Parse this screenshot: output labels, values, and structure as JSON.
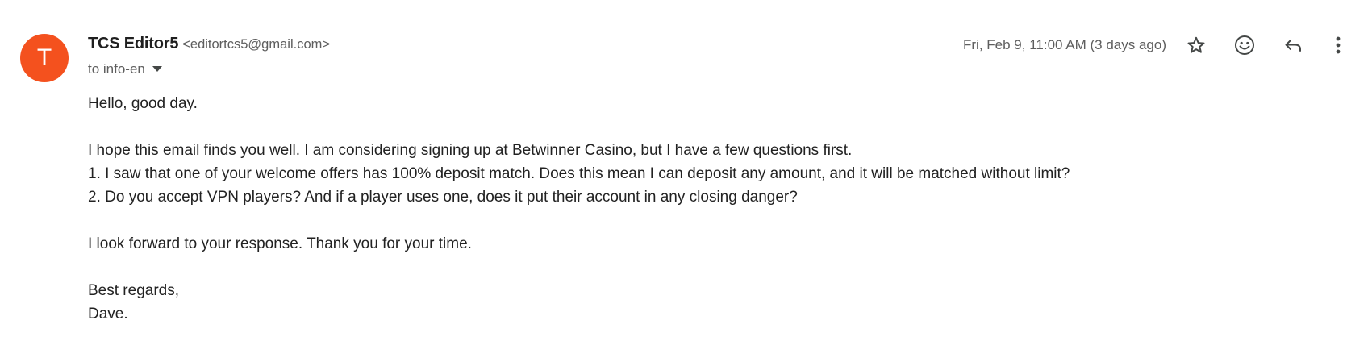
{
  "sender": {
    "avatar_letter": "T",
    "avatar_color": "#f4511e",
    "name": "TCS Editor5",
    "email": "<editortcs5@gmail.com>"
  },
  "recipient": {
    "label": "to info-en"
  },
  "date": "Fri, Feb 9, 11:00 AM (3 days ago)",
  "actions": [
    {
      "icon": "star-icon",
      "label": "Star"
    },
    {
      "icon": "emoji-icon",
      "label": "Add reaction"
    },
    {
      "icon": "reply-icon",
      "label": "Reply"
    },
    {
      "icon": "more-vert-icon",
      "label": "More"
    }
  ],
  "body": {
    "greeting": "Hello, good day.",
    "intro": "I hope this email finds you well. I am considering signing up at Betwinner Casino, but I have a few questions first.",
    "question_1": "1. I saw that one of your welcome offers has 100% deposit match. Does this mean I can deposit any amount, and it will be matched without limit?",
    "question_2": "2. Do you accept VPN players? And if a player uses one, does it put their account in any closing danger?",
    "closing_line": "I look forward to your response. Thank you for your time.",
    "sign_off": "Best regards,",
    "signature": "Dave."
  }
}
